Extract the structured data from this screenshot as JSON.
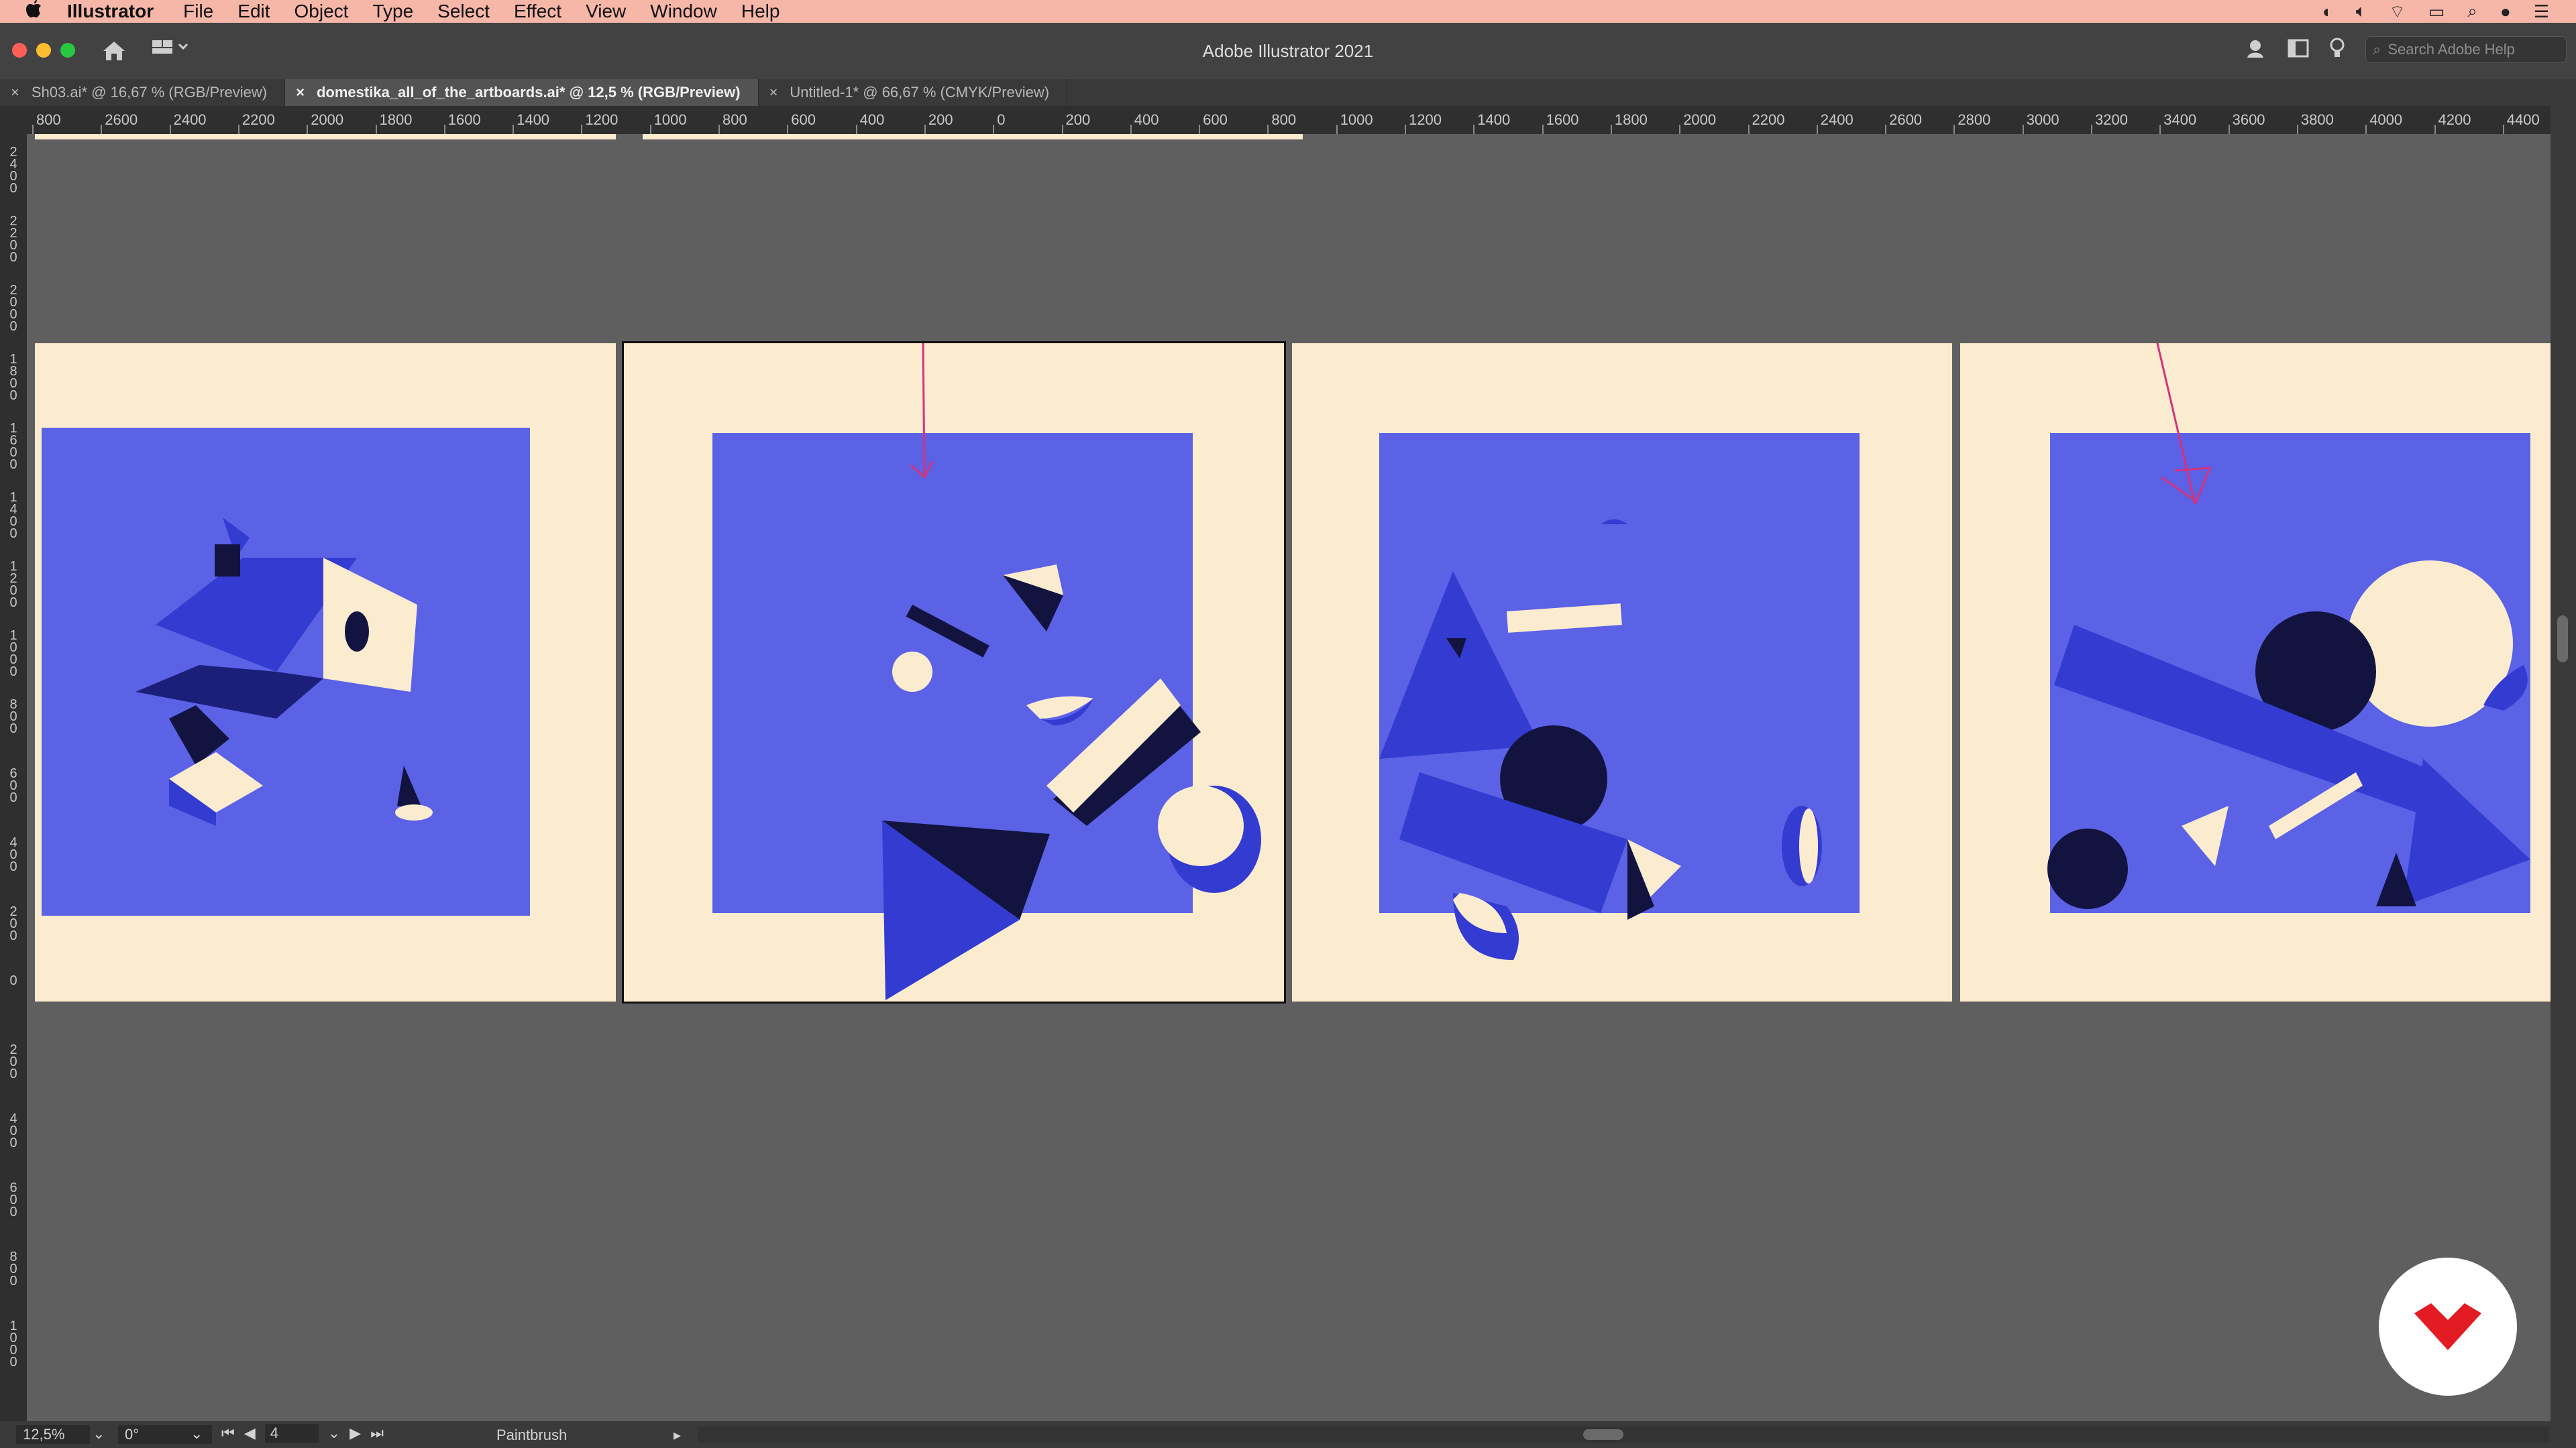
{
  "menubar": {
    "app_name": "Illustrator",
    "items": [
      "File",
      "Edit",
      "Object",
      "Type",
      "Select",
      "Effect",
      "View",
      "Window",
      "Help"
    ]
  },
  "window": {
    "title": "Adobe Illustrator 2021",
    "search_placeholder": "Search Adobe Help"
  },
  "tabs": [
    {
      "label": "Sh03.ai* @ 16,67 % (RGB/Preview)",
      "active": false
    },
    {
      "label": "domestika_all_of_the_artboards.ai* @ 12,5 % (RGB/Preview)",
      "active": true
    },
    {
      "label": "Untitled-1* @ 66,67 % (CMYK/Preview)",
      "active": false
    }
  ],
  "ruler_top": [
    "800",
    "2600",
    "2400",
    "2200",
    "2000",
    "1800",
    "1600",
    "1400",
    "1200",
    "1000",
    "800",
    "600",
    "400",
    "200",
    "0",
    "200",
    "400",
    "600",
    "800",
    "1000",
    "1200",
    "1400",
    "1600",
    "1800",
    "2000",
    "2200",
    "2400",
    "2600",
    "2800",
    "3000",
    "3200",
    "3400",
    "3600",
    "3800",
    "4000",
    "4200",
    "4400"
  ],
  "ruler_left": [
    "2400",
    "2200",
    "2000",
    "1800",
    "1600",
    "1400",
    "1200",
    "1000",
    "800",
    "600",
    "400",
    "200",
    "0",
    "200",
    "400",
    "600",
    "800",
    "1000"
  ],
  "statusbar": {
    "zoom": "12,5%",
    "rotation": "0°",
    "artboard_number": "4",
    "current_tool": "Paintbrush"
  },
  "colors": {
    "cream": "#fbecd0",
    "blue": "#5b62e6",
    "dark_blue": "#333bd1",
    "navy": "#12143f",
    "pink_stroke": "#d6327a",
    "menubar": "#f6b6a8"
  }
}
